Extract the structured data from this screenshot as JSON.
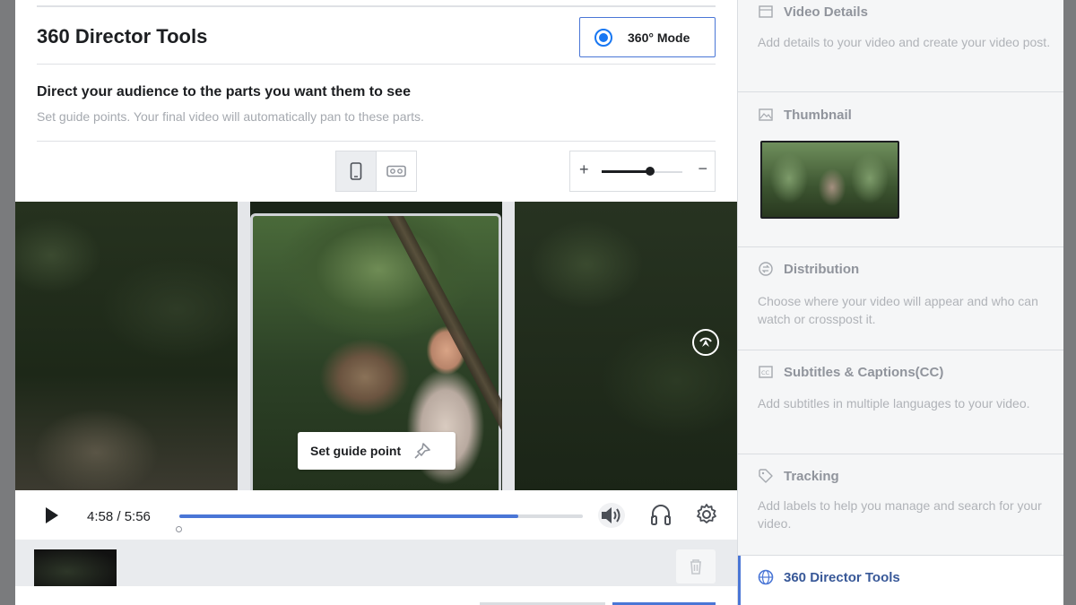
{
  "header": {
    "title": "360 Director Tools",
    "mode_button": "360° Mode"
  },
  "intro": {
    "heading": "Direct your audience to the parts you want them to see",
    "subheading": "Set guide points. Your final video will automatically pan to these parts."
  },
  "view_toggle": {
    "options": [
      "phone-icon",
      "vr-headset-icon"
    ],
    "selected": "phone-icon"
  },
  "zoom": {
    "plus_label": "+",
    "minus_label": "−",
    "level": 0.6
  },
  "video": {
    "guide_point_button": "Set guide point"
  },
  "player": {
    "time": "4:58 / 5:56",
    "progress": 0.84
  },
  "sidebar": {
    "sections": [
      {
        "title": "Video Details",
        "description": "Add details to your video and create your video post.",
        "icon": "document-icon"
      },
      {
        "title": "Thumbnail",
        "description": "",
        "icon": "image-icon"
      },
      {
        "title": "Distribution",
        "description": "Choose where your video will appear and who can watch or crosspost it.",
        "icon": "share-icon"
      },
      {
        "title": "Subtitles & Captions(CC)",
        "description": "Add subtitles in multiple languages to your video.",
        "icon": "cc-icon"
      },
      {
        "title": "Tracking",
        "description": "Add labels to help you manage and search for your video.",
        "icon": "tag-icon"
      },
      {
        "title": "360 Director Tools",
        "description": "",
        "icon": "director-icon",
        "active": true
      }
    ]
  },
  "colors": {
    "accent": "#4a76d6",
    "active_title": "#385898"
  }
}
